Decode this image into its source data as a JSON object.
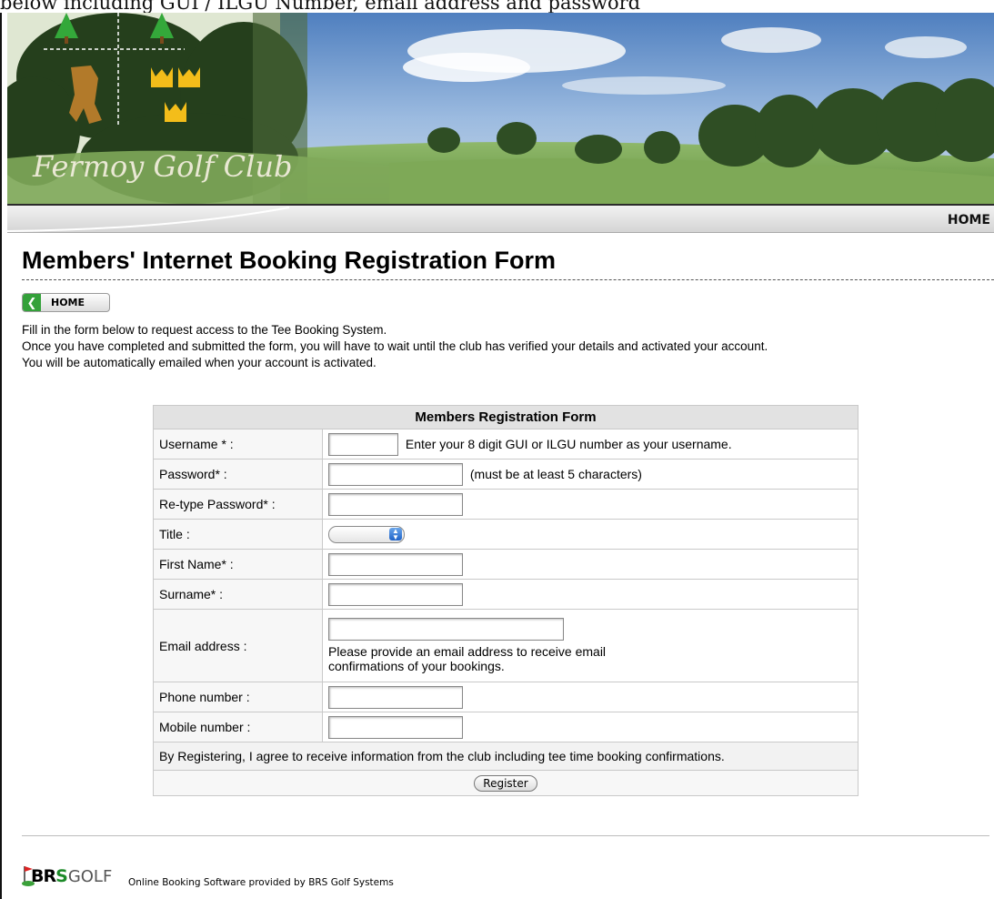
{
  "top_caption": "below including GUI / ILGU Number, email address and password",
  "banner": {
    "club_name": "Fermoy Golf Club"
  },
  "nav": {
    "home": "HOME"
  },
  "page": {
    "title": "Members' Internet Booking Registration Form",
    "home_button": "HOME",
    "intro": [
      "Fill in the form below to request access to the Tee Booking System.",
      "Once you have completed and submitted the form, you will have to wait until the club has verified your details and activated your account.",
      "You will be automatically emailed when your account is activated."
    ]
  },
  "form": {
    "heading": "Members Registration Form",
    "username_label": "Username * :",
    "username_hint": "Enter your 8 digit GUI or ILGU number as your username.",
    "password_label": "Password* :",
    "password_hint": "(must be at least 5 characters)",
    "retype_label": "Re-type Password* :",
    "title_label": "Title :",
    "title_value": "",
    "first_name_label": "First Name* :",
    "surname_label": "Surname* :",
    "email_label": "Email address :",
    "email_note_1": "Please provide an email address to receive email",
    "email_note_2": "confirmations of your bookings.",
    "phone_label": "Phone number :",
    "mobile_label": "Mobile number :",
    "agree_text": "By Registering, I agree to receive information from the club including tee time booking confirmations.",
    "register_button": "Register"
  },
  "footer": {
    "logo_b": "BR",
    "logo_s": "S",
    "logo_golf": "GOLF",
    "text": "Online Booking Software provided by BRS Golf Systems"
  }
}
